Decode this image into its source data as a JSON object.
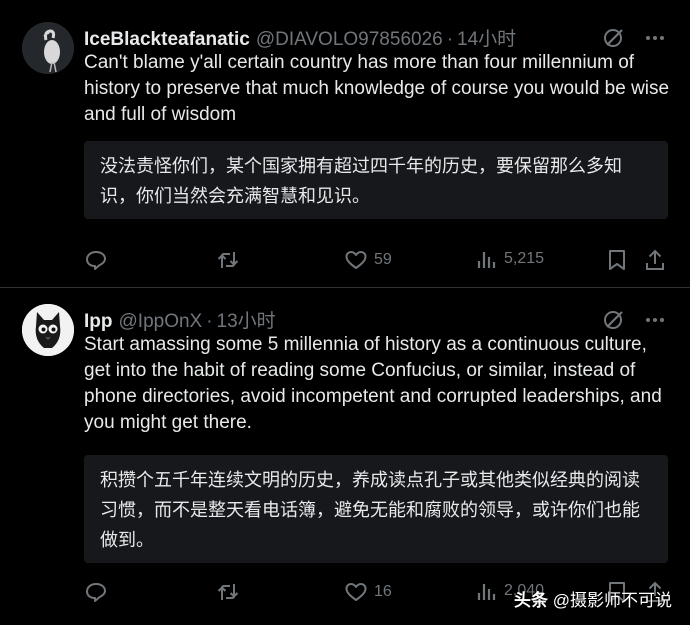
{
  "tweets": [
    {
      "name": "IceBlackteafanatic",
      "handle": "@DIAVOLO97856026",
      "separator": "·",
      "time": "14小时",
      "text": "Can't blame y'all certain country has more than four millennium of history to preserve that much knowledge of course you would be wise and full of wisdom",
      "translation": "没法责怪你们，某个国家拥有超过四千年的历史，要保留那么多知识，你们当然会充满智慧和见识。",
      "likes": "59",
      "views": "5,215"
    },
    {
      "name": "Ipp",
      "handle": "@IppOnX",
      "separator": "·",
      "time": "13小时",
      "text": "Start amassing some 5 millennia of history as a continuous culture, get into the habit of reading some Confucius, or similar, instead of phone directories, avoid incompetent and corrupted leaderships, and you might get there.",
      "translation": "积攒个五千年连续文明的历史，养成读点孔子或其他类似经典的阅读习惯，而不是整天看电话簿，避免无能和腐败的领导，或许你们也能做到。",
      "likes": "16",
      "views": "2,040"
    }
  ],
  "watermark": {
    "brand": "头条",
    "account": "@摄影师不可说"
  },
  "icons": [
    "grok-icon",
    "more-icon",
    "reply-icon",
    "retweet-icon",
    "like-icon",
    "views-icon",
    "bookmark-icon",
    "share-icon"
  ]
}
